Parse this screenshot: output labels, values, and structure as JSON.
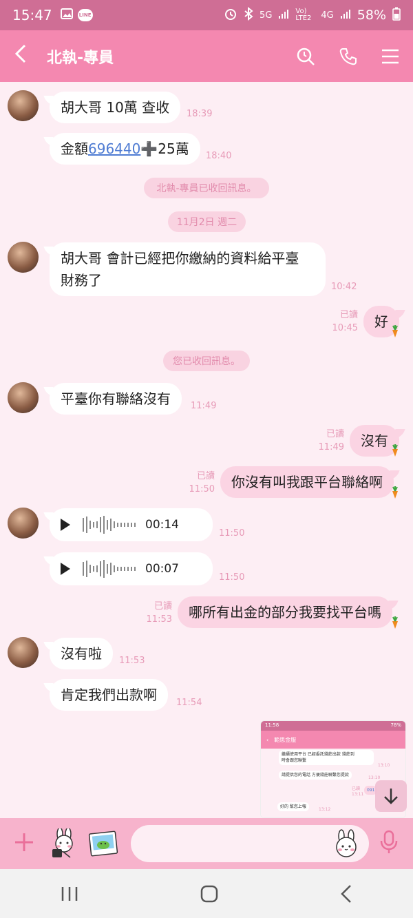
{
  "status": {
    "time": "15:47",
    "network": "5G",
    "lte": "Vo) LTE2",
    "net4g": "4G",
    "battery": "58%",
    "line_badge": "LINE"
  },
  "header": {
    "title": "北執-專員"
  },
  "messages": {
    "m1": {
      "text": "胡大哥 10萬 查收",
      "time": "18:39"
    },
    "m2": {
      "prefix": "金額",
      "link": "696440",
      "suffix": "➕25萬",
      "time": "18:40"
    },
    "sys1": "北執-專員已收回訊息。",
    "date1": "11月2日 週二",
    "m3": {
      "line1": "胡大哥 會計已經把你繳納的資料給平臺",
      "line2": "財務了",
      "time": "10:42"
    },
    "m4": {
      "text": "好",
      "read": "已讀",
      "time": "10:45"
    },
    "sys2": "您已收回訊息。",
    "m5": {
      "text": "平臺你有聯絡沒有",
      "time": "11:49"
    },
    "m6": {
      "text": "沒有",
      "read": "已讀",
      "time": "11:49"
    },
    "m7": {
      "text": "你沒有叫我跟平台聯絡啊",
      "read": "已讀",
      "time": "11:50"
    },
    "m8": {
      "duration": "00:14",
      "time": "11:50"
    },
    "m9": {
      "duration": "00:07",
      "time": "11:50"
    },
    "m10": {
      "text": "哪所有出金的部分我要找平台嗎",
      "read": "已讀",
      "time": "11:53"
    },
    "m11": {
      "text": "沒有啦",
      "time": "11:53"
    },
    "m12": {
      "text": "肯定我們出款啊",
      "time": "11:54"
    }
  },
  "thumbnail": {
    "time": "11:58",
    "battery": "78%",
    "title": "範思金服",
    "line1": "繼續使用平台 已經委託錢莊出款 錢莊到",
    "line2": "時會跟您聯繫",
    "t1": "13:10",
    "line3": "請提供您的電話 方便錢莊聯繫您提款",
    "t2": "13:10",
    "read": "已讀",
    "t3": "13:11",
    "num": "091",
    "line4": "好的 幫您上報",
    "t4": "13:12"
  },
  "input": {
    "placeholder": ""
  }
}
